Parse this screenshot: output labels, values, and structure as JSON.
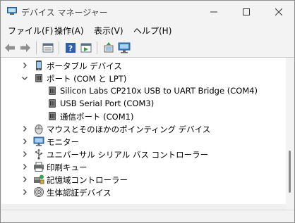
{
  "window": {
    "title": "デバイス マネージャー"
  },
  "menu": [
    "ファイル(F)",
    "操作(A)",
    "表示(V)",
    "ヘルプ(H)"
  ],
  "toolbar": [
    "back-icon",
    "forward-icon",
    "properties-icon",
    "help-icon",
    "show-hidden-icon",
    "scan-hardware-icon",
    "monitor-device-icon"
  ],
  "tree": [
    {
      "label": "ポータブル デバイス",
      "level": 1,
      "expander": "collapsed",
      "icon": "portable-device-icon",
      "interactable": true
    },
    {
      "label": "ポート (COM と LPT)",
      "level": 1,
      "expander": "expanded",
      "icon": "port-icon",
      "interactable": true
    },
    {
      "label": "Silicon Labs CP210x USB to UART Bridge (COM4)",
      "level": 2,
      "expander": "none",
      "icon": "port-icon",
      "interactable": true
    },
    {
      "label": "USB Serial Port (COM3)",
      "level": 2,
      "expander": "none",
      "icon": "port-icon",
      "interactable": true
    },
    {
      "label": "通信ポート (COM1)",
      "level": 2,
      "expander": "none",
      "icon": "port-icon",
      "interactable": true
    },
    {
      "label": "マウスとそのほかのポインティング デバイス",
      "level": 1,
      "expander": "collapsed",
      "icon": "mouse-icon",
      "interactable": true
    },
    {
      "label": "モニター",
      "level": 1,
      "expander": "collapsed",
      "icon": "monitor-icon",
      "interactable": true
    },
    {
      "label": "ユニバーサル シリアル バス コントローラー",
      "level": 1,
      "expander": "collapsed",
      "icon": "usb-icon",
      "interactable": true
    },
    {
      "label": "印刷キュー",
      "level": 1,
      "expander": "collapsed",
      "icon": "printer-icon",
      "interactable": true
    },
    {
      "label": "記憶域コントローラー",
      "level": 1,
      "expander": "collapsed",
      "icon": "storage-controller-icon",
      "interactable": true
    },
    {
      "label": "生体認証デバイス",
      "level": 1,
      "expander": "collapsed",
      "icon": "fingerprint-icon",
      "interactable": true
    }
  ]
}
